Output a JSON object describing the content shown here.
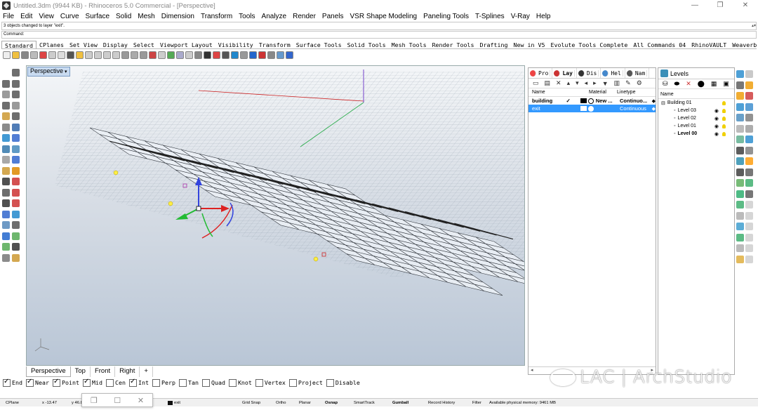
{
  "window": {
    "title": "Untitled.3dm (9944 KB) - Rhinoceros 5.0 Commercial - [Perspective]",
    "controls": [
      "—",
      "❐",
      "✕"
    ]
  },
  "menu": [
    "File",
    "Edit",
    "View",
    "Curve",
    "Surface",
    "Solid",
    "Mesh",
    "Dimension",
    "Transform",
    "Tools",
    "Analyze",
    "Render",
    "Panels",
    "VSR Shape Modeling",
    "Paneling Tools",
    "T-Splines",
    "V-Ray",
    "Help"
  ],
  "command": {
    "history": "3 objects changed to layer \"exit\".",
    "prompt": "Command:"
  },
  "toolbar_tabs": [
    "Standard",
    "CPlanes",
    "Set View",
    "Display",
    "Select",
    "Viewport Layout",
    "Visibility",
    "Transform",
    "Surface Tools",
    "Solid Tools",
    "Mesh Tools",
    "Render Tools",
    "Drafting",
    "New in V5",
    "Evolute Tools Complete",
    "All Commands 04",
    "RhinoVAULT",
    "Weaverbir"
  ],
  "viewport": {
    "label": "Perspective",
    "tabs": [
      "Perspective",
      "Top",
      "Front",
      "Right",
      "+"
    ]
  },
  "osnap": [
    {
      "label": "End",
      "checked": true
    },
    {
      "label": "Near",
      "checked": true
    },
    {
      "label": "Point",
      "checked": true
    },
    {
      "label": "Mid",
      "checked": true
    },
    {
      "label": "Cen",
      "checked": false
    },
    {
      "label": "Int",
      "checked": true
    },
    {
      "label": "Perp",
      "checked": false
    },
    {
      "label": "Tan",
      "checked": false
    },
    {
      "label": "Quad",
      "checked": false
    },
    {
      "label": "Knot",
      "checked": false
    },
    {
      "label": "Vertex",
      "checked": false
    },
    {
      "label": "Project",
      "checked": false
    },
    {
      "label": "Disable",
      "checked": false
    }
  ],
  "status": {
    "cplane": "CPlane",
    "x": "x -13.47",
    "y": "y 46.8",
    "layer": "exit",
    "grid_snap": "Grid Snap",
    "ortho": "Ortho",
    "planar": "Planar",
    "osnap": "Osnap",
    "smarttrack": "SmartTrack",
    "gumball": "Gumball",
    "record_history": "Record History",
    "filter": "Filter",
    "memory": "Available physical memory: 9461 MB"
  },
  "layers_panel": {
    "tabs": [
      "Pro",
      "Lay",
      "Dis",
      "Hel",
      "Nam"
    ],
    "tools": [
      "▭",
      "▤",
      "✕",
      "▴",
      "▾",
      "◂",
      "▸",
      "▼",
      "▥",
      "✎",
      "⚙"
    ],
    "headers": {
      "name": "Name",
      "material": "Material",
      "linetype": "Linetype"
    },
    "rows": [
      {
        "name": "building",
        "check": "✓",
        "material": "New ...",
        "linetype": "Continuo...",
        "selected": false
      },
      {
        "name": "exit",
        "check": "",
        "material": "",
        "linetype": "Continuous",
        "selected": true
      }
    ],
    "scroll_left": "◂",
    "scroll_right": "▸"
  },
  "levels_panel": {
    "tab": "Levels",
    "tools": [
      "⛁",
      "⬬",
      "✕",
      "⬤",
      "▦",
      "▣"
    ],
    "header": "Name",
    "tree": [
      {
        "label": "Building 01",
        "indent": 0,
        "bold": false,
        "prefix": "⊟"
      },
      {
        "label": "Level 03",
        "indent": 1,
        "bold": false,
        "prefix": "◦"
      },
      {
        "label": "Level 02",
        "indent": 1,
        "bold": false,
        "prefix": "◦"
      },
      {
        "label": "Level 01",
        "indent": 1,
        "bold": false,
        "prefix": "◦"
      },
      {
        "label": "Level 00",
        "indent": 1,
        "bold": true,
        "prefix": "◦"
      }
    ]
  },
  "watermark": "LAC | ArchStudio",
  "colors": {
    "selection": "#3399ff",
    "viewport_top": "#f4f6f8",
    "viewport_bottom": "#b9c6d6",
    "axis_x": "#cc2222",
    "axis_y": "#22aa44",
    "axis_z": "#7744cc"
  }
}
